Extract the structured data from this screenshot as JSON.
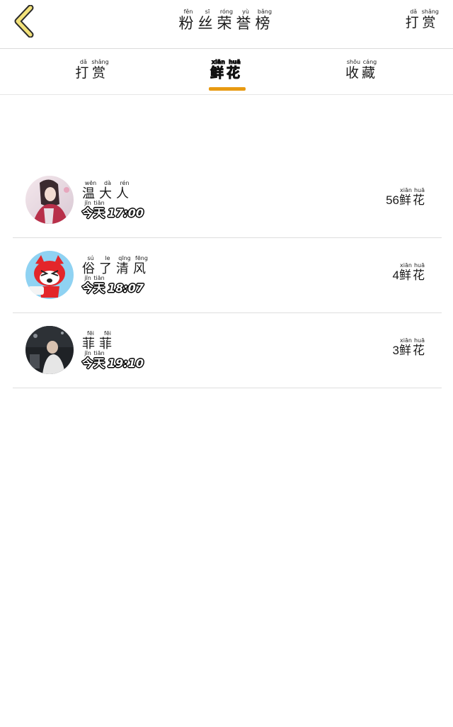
{
  "header": {
    "title": [
      {
        "char": "粉",
        "py": "fěn"
      },
      {
        "char": "丝",
        "py": "sī"
      },
      {
        "char": "荣",
        "py": "róng"
      },
      {
        "char": "誉",
        "py": "yù"
      },
      {
        "char": "榜",
        "py": "bǎng"
      }
    ],
    "tip_button": [
      {
        "char": "打",
        "py": "dǎ"
      },
      {
        "char": "赏",
        "py": "shǎng"
      }
    ]
  },
  "tabs": [
    {
      "chars": [
        {
          "char": "打",
          "py": "dǎ"
        },
        {
          "char": "赏",
          "py": "shǎng"
        }
      ]
    },
    {
      "chars": [
        {
          "char": "鲜",
          "py": "xiān"
        },
        {
          "char": "花",
          "py": "huā"
        }
      ],
      "active": true
    },
    {
      "chars": [
        {
          "char": "收",
          "py": "shōu"
        },
        {
          "char": "藏",
          "py": "cáng"
        }
      ]
    }
  ],
  "colors": {
    "accent": "#e89a12",
    "divider": "#dedede"
  },
  "fans": [
    {
      "name": [
        {
          "char": "温",
          "py": "wēn"
        },
        {
          "char": "大",
          "py": "dà"
        },
        {
          "char": "人",
          "py": "rén"
        }
      ],
      "day": [
        {
          "char": "今",
          "py": "jīn"
        },
        {
          "char": "天",
          "py": "tiān"
        }
      ],
      "time": "17:00",
      "count": "56",
      "unit": [
        {
          "char": "鲜",
          "py": "xiān"
        },
        {
          "char": "花",
          "py": "huā"
        }
      ]
    },
    {
      "name": [
        {
          "char": "俗",
          "py": "sú"
        },
        {
          "char": "了",
          "py": "le"
        },
        {
          "char": "清",
          "py": "qīng"
        },
        {
          "char": "风",
          "py": "fēng"
        }
      ],
      "day": [
        {
          "char": "今",
          "py": "jīn"
        },
        {
          "char": "天",
          "py": "tiān"
        }
      ],
      "time": "18:07",
      "count": "4",
      "unit": [
        {
          "char": "鲜",
          "py": "xiān"
        },
        {
          "char": "花",
          "py": "huā"
        }
      ]
    },
    {
      "name": [
        {
          "char": "菲",
          "py": "fēi"
        },
        {
          "char": "菲",
          "py": "fēi"
        }
      ],
      "day": [
        {
          "char": "今",
          "py": "jīn"
        },
        {
          "char": "天",
          "py": "tiān"
        }
      ],
      "time": "19:10",
      "count": "3",
      "unit": [
        {
          "char": "鲜",
          "py": "xiān"
        },
        {
          "char": "花",
          "py": "huā"
        }
      ]
    }
  ]
}
